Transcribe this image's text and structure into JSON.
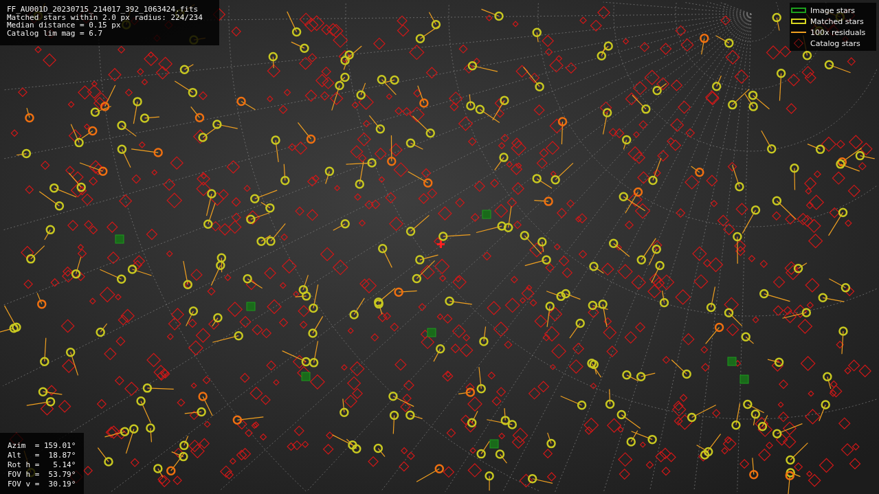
{
  "info_lines": [
    "FF_AU001D_20230715_214017_392_1063424.fits",
    "Matched stars within 2.0 px radius: 224/234",
    "Median distance = 0.15 px",
    "Catalog lim mag = 6.7"
  ],
  "legend": [
    {
      "kind": "image",
      "label": "Image stars"
    },
    {
      "kind": "matched",
      "label": "Matched stars"
    },
    {
      "kind": "residual",
      "label": "100x residuals"
    },
    {
      "kind": "catalog",
      "label": "Catalog stars"
    }
  ],
  "pointing_lines": [
    "Azim  = 159.01°",
    "Alt   =  18.87°",
    "Rot h =   5.14°",
    "FOV h =  53.79°",
    "FOV v =  30.19°"
  ]
}
